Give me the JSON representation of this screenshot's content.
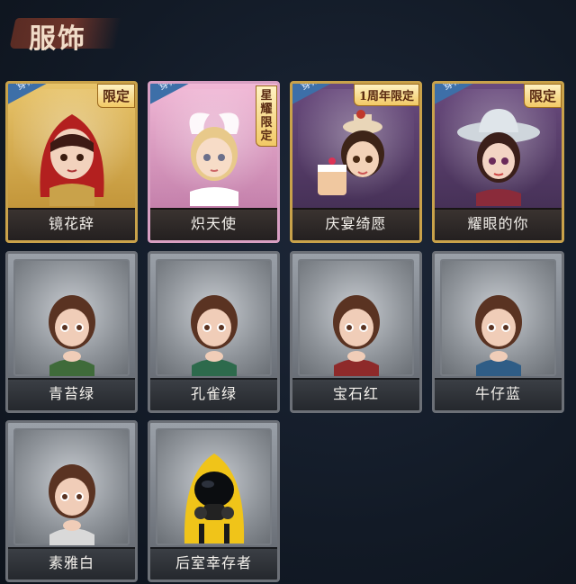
{
  "page": {
    "title": "服饰"
  },
  "wear_label": "穿戴",
  "costumes": [
    {
      "name": "镜花辞",
      "badge": "限定",
      "style": "gold",
      "worn": true,
      "theme": "red-hood"
    },
    {
      "name": "炽天使",
      "badge": "星耀限定",
      "style": "pink",
      "worn": true,
      "theme": "angel"
    },
    {
      "name": "庆宴绮愿",
      "badge": "1周年限定",
      "style": "purple",
      "worn": true,
      "theme": "party"
    },
    {
      "name": "耀眼的你",
      "badge": "限定",
      "style": "purple",
      "worn": true,
      "theme": "cowgirl"
    },
    {
      "name": "青苔绿",
      "badge": "",
      "style": "grey",
      "worn": false,
      "theme": "green"
    },
    {
      "name": "孔雀绿",
      "badge": "",
      "style": "grey",
      "worn": false,
      "theme": "peacock"
    },
    {
      "name": "宝石红",
      "badge": "",
      "style": "grey",
      "worn": false,
      "theme": "red"
    },
    {
      "name": "牛仔蓝",
      "badge": "",
      "style": "grey",
      "worn": false,
      "theme": "blue"
    },
    {
      "name": "素雅白",
      "badge": "",
      "style": "grey",
      "worn": false,
      "theme": "white"
    },
    {
      "name": "后室幸存者",
      "badge": "",
      "style": "grey",
      "worn": false,
      "theme": "hazmat"
    }
  ],
  "colors": {
    "background": "#121a26",
    "wear_tag": "#3d6fa8",
    "gold_frame": "#c9a24a",
    "label_text": "#f4f1ec"
  }
}
